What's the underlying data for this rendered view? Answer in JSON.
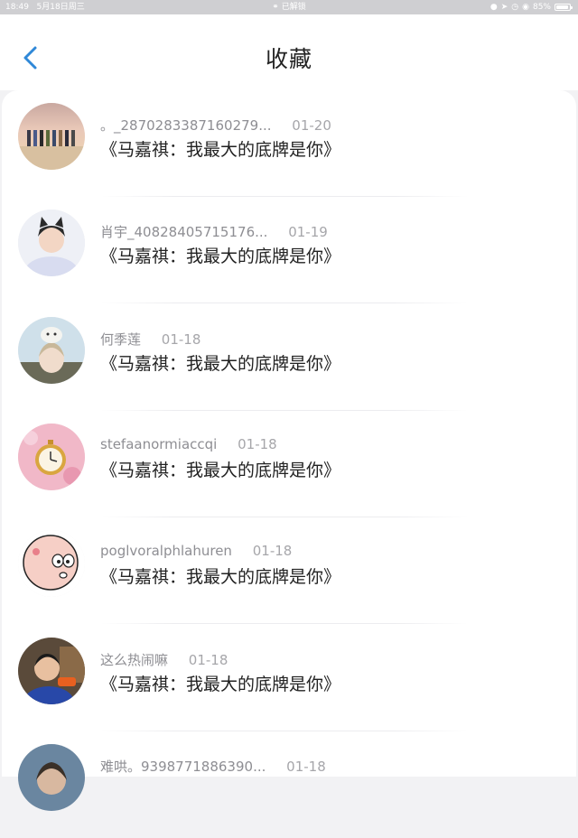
{
  "status_bar": {
    "time": "18:49",
    "date": "5月18日周三",
    "lock_text": "已解锁",
    "battery": "85%",
    "battery_level": 0.85
  },
  "header": {
    "title": "收藏",
    "accent": "#2f88d8"
  },
  "items": [
    {
      "username": "。_2870283387160279...",
      "date": "01-20",
      "content": "《马嘉祺：我最大的底牌是你》",
      "avatar": "group-photo-avatar"
    },
    {
      "username": "肖宇_40828405715176...",
      "date": "01-19",
      "content": "《马嘉祺：我最大的底牌是你》",
      "avatar": "cat-ears-boy-avatar"
    },
    {
      "username": "何季莲",
      "date": "01-18",
      "content": "《马嘉祺：我最大的底牌是你》",
      "avatar": "anime-cat-avatar"
    },
    {
      "username": "stefaanormiaccqi",
      "date": "01-18",
      "content": "《马嘉祺：我最大的底牌是你》",
      "avatar": "pocket-watch-avatar"
    },
    {
      "username": "poglvoralphlahuren",
      "date": "01-18",
      "content": "《马嘉祺：我最大的底牌是你》",
      "avatar": "cartoon-face-avatar"
    },
    {
      "username": "这么热闹嘛",
      "date": "01-18",
      "content": "《马嘉祺：我最大的底牌是你》",
      "avatar": "boy-portrait-avatar"
    },
    {
      "username": "难哄。9398771886390...",
      "date": "01-18",
      "content": "",
      "avatar": "partial-avatar"
    }
  ]
}
